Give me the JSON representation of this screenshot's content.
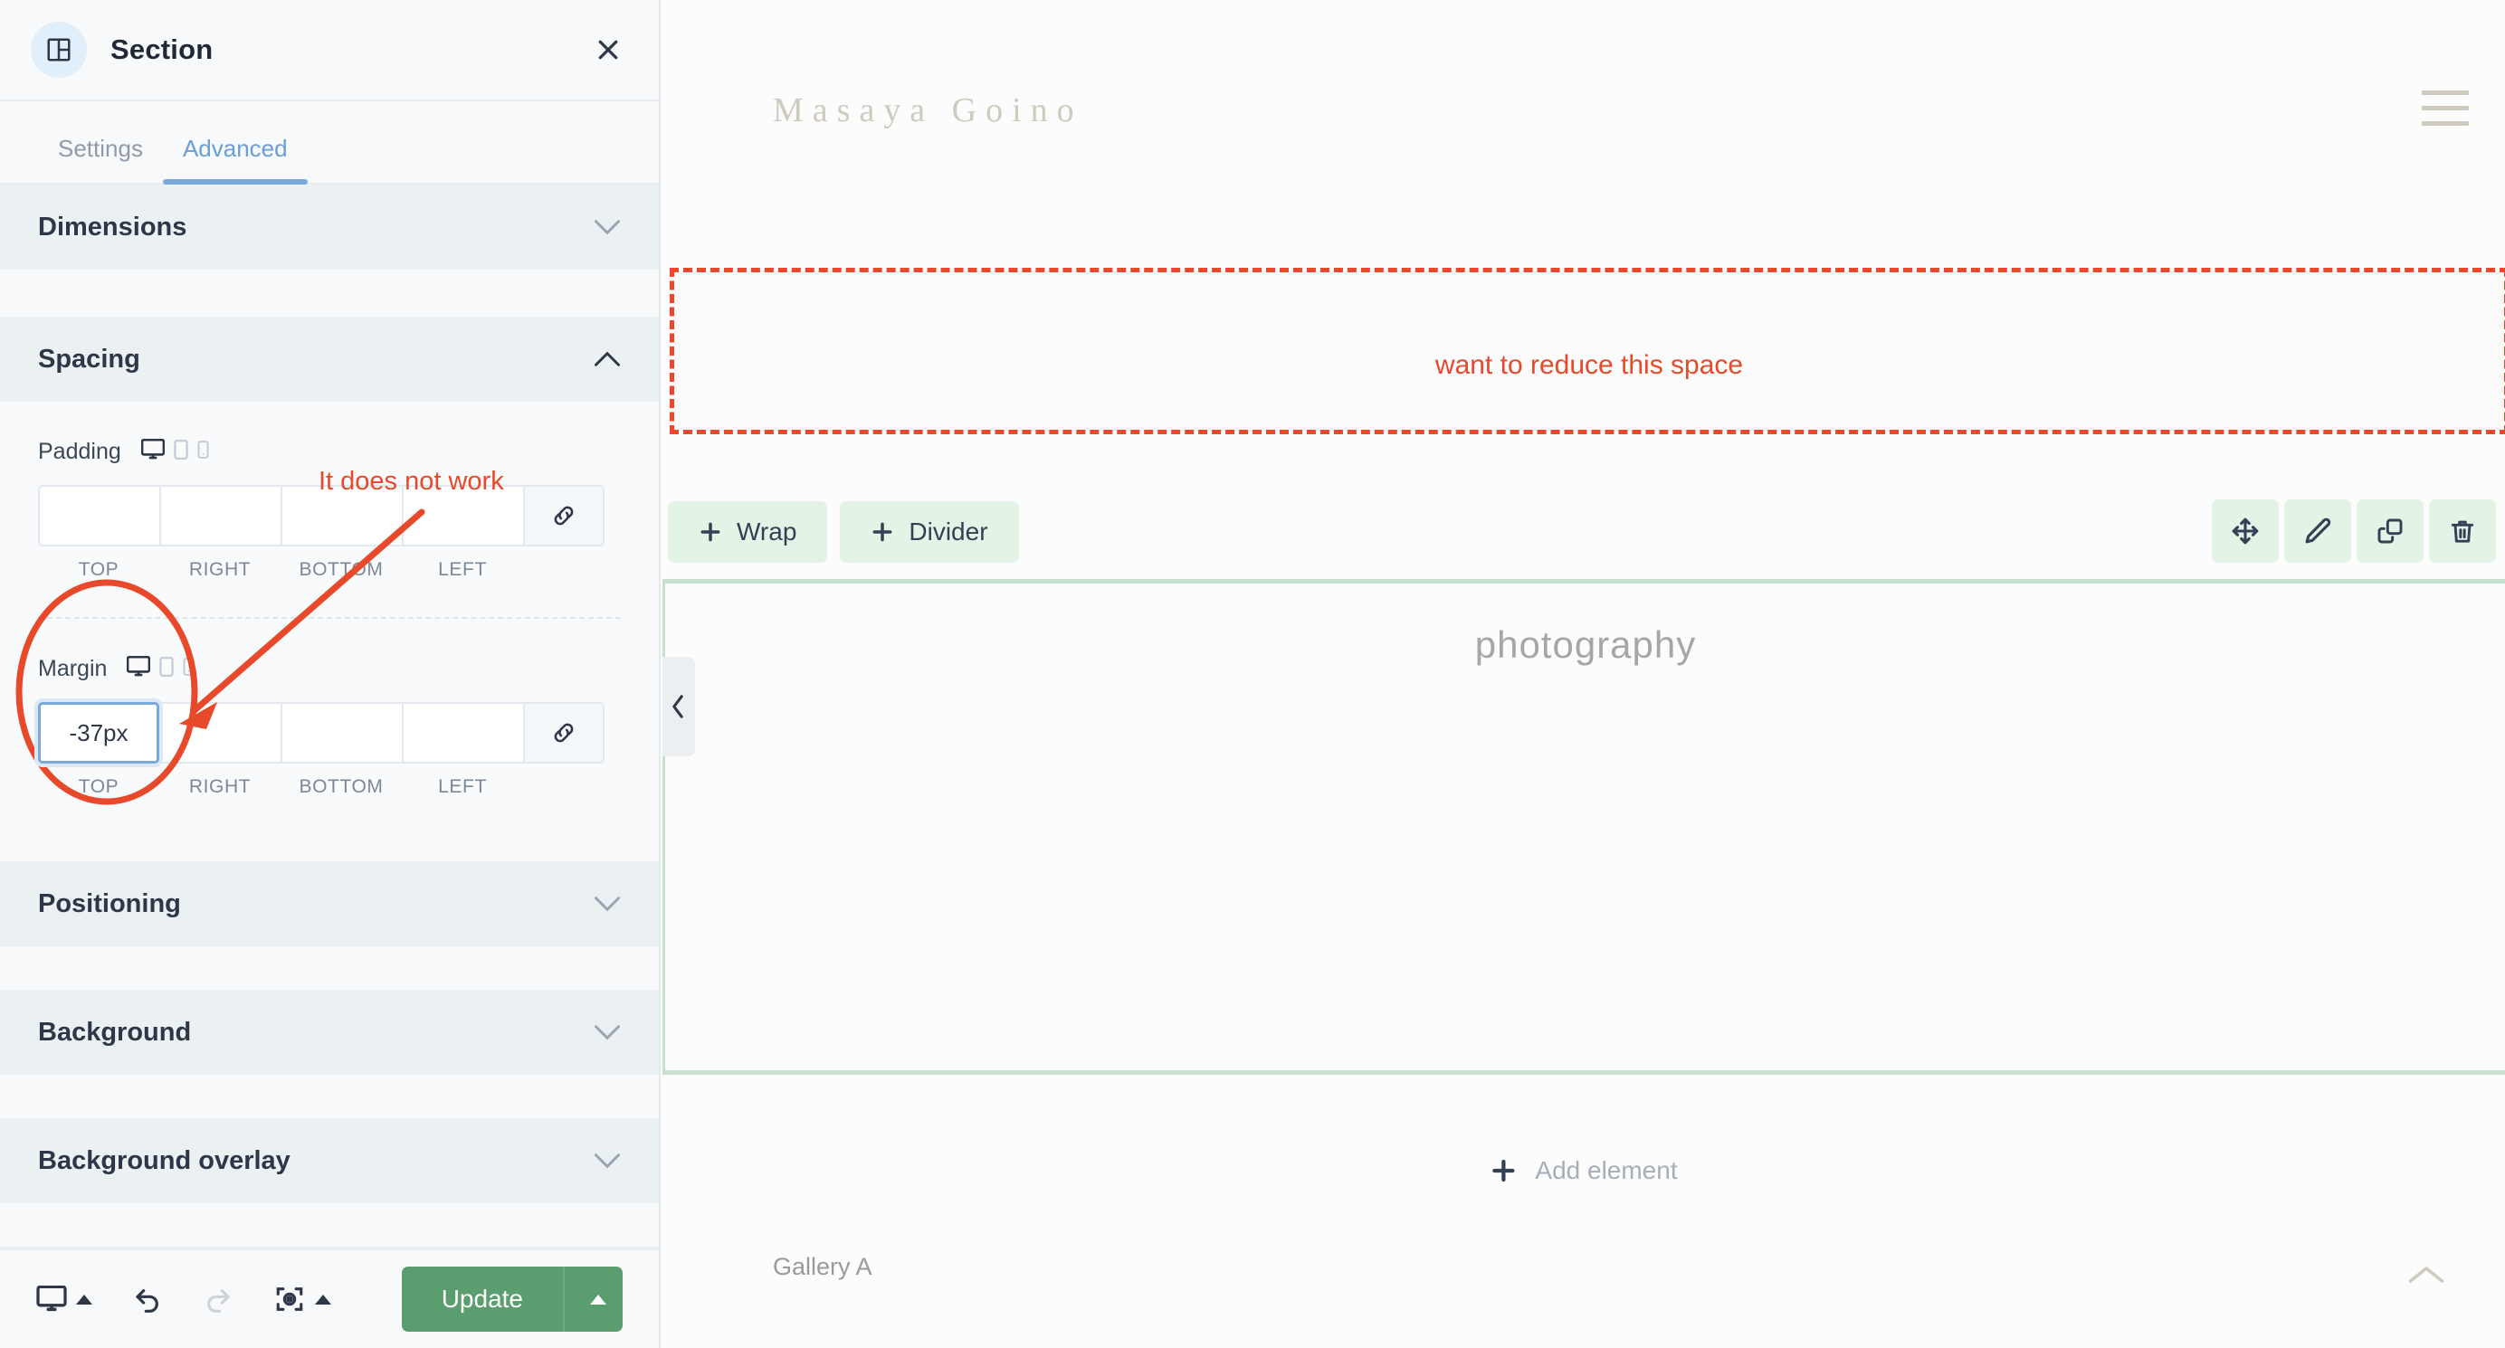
{
  "panel": {
    "header": {
      "icon": "section-layout-icon",
      "title": "Section",
      "close_icon": "close-icon"
    },
    "tabs": [
      {
        "label": "Settings",
        "active": false
      },
      {
        "label": "Advanced",
        "active": true
      }
    ],
    "accordions": [
      {
        "label": "Dimensions",
        "expanded": false
      },
      {
        "label": "Spacing",
        "expanded": true
      },
      {
        "label": "Positioning",
        "expanded": false
      },
      {
        "label": "Background",
        "expanded": false
      },
      {
        "label": "Background overlay",
        "expanded": false
      }
    ],
    "spacing": {
      "padding": {
        "label": "Padding",
        "devices": [
          "desktop-icon",
          "tablet-icon",
          "mobile-icon"
        ],
        "active_device": "desktop-icon",
        "values": [
          "",
          "",
          "",
          ""
        ],
        "captions": [
          "TOP",
          "RIGHT",
          "BOTTOM",
          "LEFT"
        ],
        "link_icon": "link-icon"
      },
      "margin": {
        "label": "Margin",
        "devices": [
          "desktop-icon",
          "tablet-icon",
          "mobile-icon"
        ],
        "active_device": "desktop-icon",
        "values": [
          "-37px",
          "",
          "",
          ""
        ],
        "captions": [
          "TOP",
          "RIGHT",
          "BOTTOM",
          "LEFT"
        ],
        "link_icon": "link-icon",
        "focused_index": 0
      }
    },
    "footer": {
      "device_icon": "desktop-icon",
      "undo_icon": "undo-icon",
      "redo_icon": "redo-icon",
      "preview_icon": "responsive-preview-icon",
      "update_label": "Update",
      "update_arrow_icon": "caret-up-icon",
      "accent_color": "#5a9e6f"
    }
  },
  "annotations": {
    "color": "#e8492a",
    "panel_note": "It does not work",
    "canvas_note": "want to reduce this space",
    "circle_target": "margin-top-input",
    "arrow_target": "padding-row"
  },
  "canvas": {
    "site_title": "Masaya Goino",
    "menu_icon": "hamburger-menu-icon",
    "selected_section": {
      "outline_color": "#e8492a",
      "add_buttons": [
        {
          "label": "Wrap",
          "icon": "plus-icon"
        },
        {
          "label": "Divider",
          "icon": "plus-icon"
        }
      ],
      "tools": [
        {
          "icon": "move-icon",
          "name": "move"
        },
        {
          "icon": "pencil-icon",
          "name": "edit"
        },
        {
          "icon": "duplicate-icon",
          "name": "duplicate"
        },
        {
          "icon": "trash-icon",
          "name": "delete"
        }
      ]
    },
    "green_section": {
      "outline_color": "#c8e0ce",
      "heading": "photography"
    },
    "collapse_icon": "chevron-left-icon",
    "add_element": {
      "label": "Add element",
      "icon": "plus-icon"
    },
    "gallery_label": "Gallery A",
    "to_top_icon": "chevron-up-icon"
  }
}
